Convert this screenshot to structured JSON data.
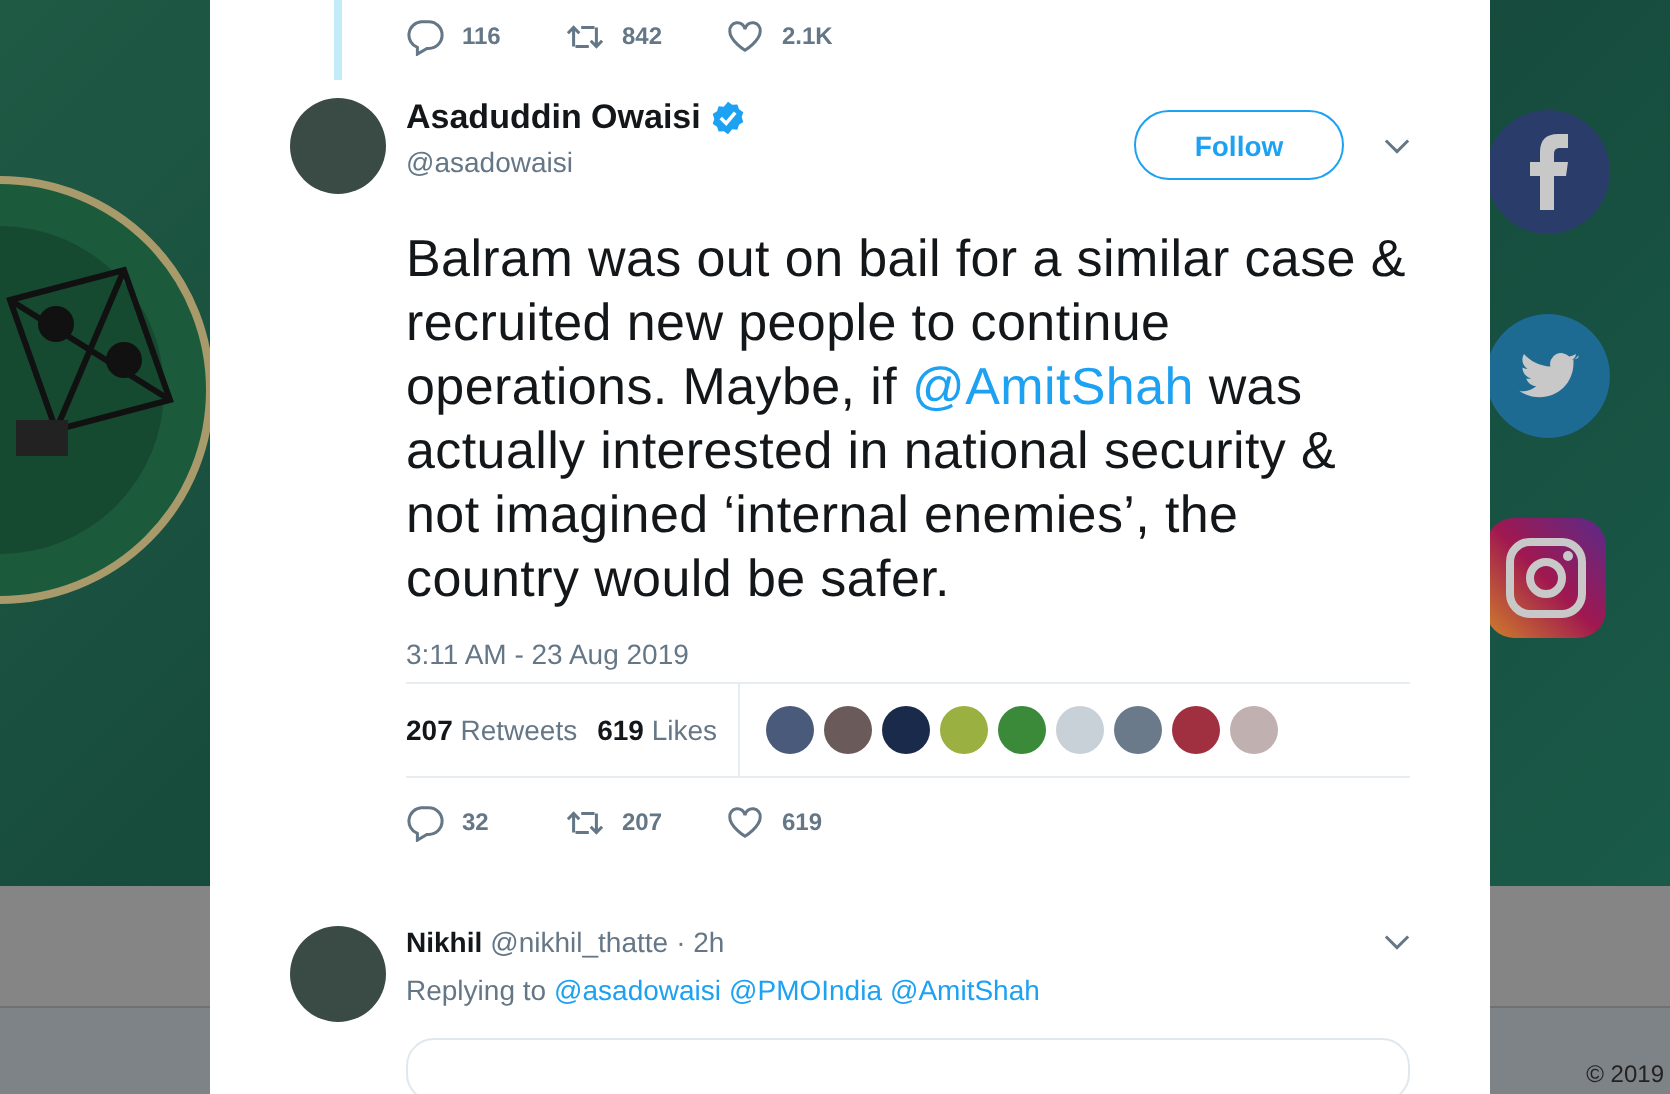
{
  "previous_tweet": {
    "actions": [
      {
        "kind": "reply",
        "count": "116"
      },
      {
        "kind": "retweet",
        "count": "842"
      },
      {
        "kind": "like",
        "count": "2.1K"
      }
    ]
  },
  "tweet": {
    "author": {
      "name": "Asaduddin Owaisi",
      "handle": "@asadowaisi",
      "verified": true
    },
    "follow_button": "Follow",
    "text": [
      {
        "kind": "text",
        "text": "Balram was out on bail for a similar case & recruited new people to continue operations. Maybe, if "
      },
      {
        "kind": "mention",
        "text": "@AmitShah"
      },
      {
        "kind": "text",
        "text": " was actually interested in national security & not imagined ‘internal enemies’, the country would be safer."
      }
    ],
    "timestamp": "3:11 AM - 23 Aug 2019",
    "stats": [
      {
        "count": "207",
        "label": "Retweets"
      },
      {
        "count": "619",
        "label": "Likes"
      }
    ],
    "actions": [
      {
        "kind": "reply",
        "count": "32"
      },
      {
        "kind": "retweet",
        "count": "207"
      },
      {
        "kind": "like",
        "count": "619"
      }
    ]
  },
  "reply": {
    "author": {
      "name": "Nikhil",
      "handle": "@nikhil_thatte",
      "time": "· 2h"
    },
    "replying_label": "Replying to",
    "mentions": [
      "@asadowaisi",
      "@PMOIndia",
      "@AmitShah"
    ]
  },
  "site": {
    "copyright": "© 2019"
  }
}
